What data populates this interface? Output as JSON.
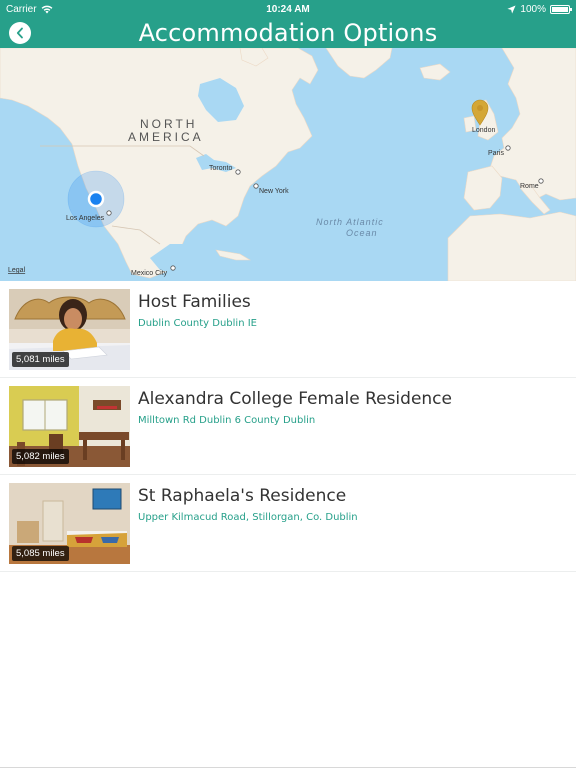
{
  "status": {
    "carrier": "Carrier",
    "time": "10:24 AM",
    "battery": "100%"
  },
  "navbar": {
    "title": "Accommodation Options",
    "back_icon": "chevron-left-icon"
  },
  "map": {
    "labels": {
      "north": "NORTH",
      "america": "AMERICA",
      "toronto": "Toronto",
      "newyork": "New York",
      "losangeles": "Los Angeles",
      "mexicocity": "Mexico City",
      "ocean1": "North Atlantic",
      "ocean2": "Ocean",
      "london": "London",
      "paris": "Paris",
      "rome": "Rome",
      "legal": "Legal"
    },
    "colors": {
      "water": "#a9d8f3",
      "land": "#f5f1e8",
      "pin": "#d4a736",
      "user": "#1a82f0"
    }
  },
  "accommodations": [
    {
      "title": "Host Families",
      "address": "Dublin County Dublin IE",
      "distance": "5,081 miles"
    },
    {
      "title": "Alexandra College Female Residence",
      "address": "Milltown Rd Dublin 6 County Dublin",
      "distance": "5,082 miles"
    },
    {
      "title": "St Raphaela's Residence",
      "address": "Upper Kilmacud Road, Stillorgan, Co. Dublin",
      "distance": "5,085 miles"
    }
  ]
}
